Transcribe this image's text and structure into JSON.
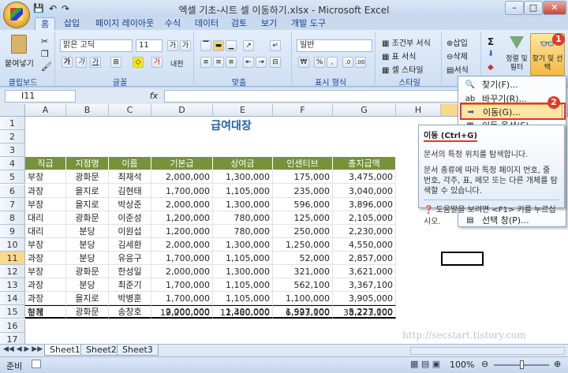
{
  "window": {
    "title": "엑셀 기초-시트 셀 이동하기.xlsx - Microsoft Excel",
    "min": "–",
    "max": "□",
    "close": "✕"
  },
  "qat": {
    "save": "💾",
    "undo": "↶",
    "redo": "↷"
  },
  "tabs": [
    "홈",
    "삽입",
    "페이지 레이아웃",
    "수식",
    "데이터",
    "검토",
    "보기",
    "개발 도구"
  ],
  "ribbon": {
    "clipboard": {
      "paste": "붙여넣기",
      "label": "클립보드"
    },
    "font": {
      "name": "맑은 고딕",
      "size": "11",
      "bold": "가",
      "italic": "가",
      "underline": "가",
      "grow": "가",
      "shrink": "가",
      "fontcolor": "가",
      "phonetic": "내천",
      "label": "글꼴"
    },
    "align": {
      "label": "맞춤"
    },
    "number": {
      "format": "일반",
      "percent": "%",
      "comma": ",",
      "currency": "₩",
      "label": "표시 형식"
    },
    "styles": {
      "cond": "조건부 서식",
      "table": "표 서식",
      "cell": "셀 스타일",
      "label": "스타일"
    },
    "cells": {
      "insert": "삽입",
      "delete": "삭제",
      "format": "서식"
    },
    "editing": {
      "sort": "정렬 및 필터",
      "find": "찾기 및 선택"
    }
  },
  "formula": {
    "namebox": "I11",
    "fx": "fx",
    "value": ""
  },
  "columns": [
    "A",
    "B",
    "C",
    "D",
    "E",
    "F",
    "G",
    "H",
    "I"
  ],
  "rows": [
    "1",
    "2",
    "3",
    "4",
    "5",
    "6",
    "7",
    "8",
    "9",
    "10",
    "11",
    "12",
    "13",
    "14",
    "15",
    "16",
    "17"
  ],
  "sheet": {
    "title": "급여대장",
    "headers": [
      "직급",
      "지점명",
      "이름",
      "기본급",
      "상여금",
      "인센티브",
      "총지급액"
    ],
    "data": [
      [
        "부장",
        "광화문",
        "최재석",
        "2,000,000",
        "1,300,000",
        "175,000",
        "3,475,000"
      ],
      [
        "과장",
        "을지로",
        "김현태",
        "1,700,000",
        "1,105,000",
        "235,000",
        "3,040,000"
      ],
      [
        "부장",
        "을지로",
        "박상준",
        "2,000,000",
        "1,300,000",
        "596,000",
        "3,896,000"
      ],
      [
        "대리",
        "광화문",
        "이준성",
        "1,200,000",
        "780,000",
        "125,000",
        "2,105,000"
      ],
      [
        "대리",
        "분당",
        "이원섭",
        "1,200,000",
        "780,000",
        "250,000",
        "2,230,000"
      ],
      [
        "부장",
        "분당",
        "김세환",
        "2,000,000",
        "1,300,000",
        "1,250,000",
        "4,550,000"
      ],
      [
        "과장",
        "분당",
        "유응구",
        "1,700,000",
        "1,105,000",
        "52,000",
        "2,857,000"
      ],
      [
        "부장",
        "광화문",
        "한성일",
        "2,000,000",
        "1,300,000",
        "321,000",
        "3,621,000"
      ],
      [
        "과장",
        "분당",
        "최준기",
        "1,700,000",
        "1,105,000",
        "562,100",
        "3,367,100"
      ],
      [
        "과장",
        "을지로",
        "박병훈",
        "1,700,000",
        "1,105,000",
        "1,100,000",
        "3,905,000"
      ],
      [
        "부장",
        "광화문",
        "송창호",
        "2,000,000",
        "1,300,000",
        "1,927,000",
        "5,227,000"
      ]
    ],
    "total": [
      "합계",
      "",
      "",
      "19,200,000",
      "12,480,000",
      "6,593,100",
      "38,273,100"
    ]
  },
  "menu": {
    "items": [
      "찾기(F)...",
      "바꾸기(R)...",
      "이동(G)...",
      "이동 옵션(S)...",
      "",
      "",
      "",
      "",
      "선택 창(P)..."
    ]
  },
  "tooltip": {
    "title": "이동 (Ctrl+G)",
    "line1": "문서의 특정 위치를 탐색합니다.",
    "line2": "문서 종류에 따라 특정 페이지 번호, 줄 번호, 각주, 표, 메모 또는 다른 개체를 탐색할 수 있습니다.",
    "help": "도움말을 보려면 <F1> 키를 누르십시오."
  },
  "badges": {
    "b1": "1",
    "b2": "2"
  },
  "sheettabs": [
    "Sheet1",
    "Sheet2",
    "Sheet3"
  ],
  "status": {
    "ready": "준비",
    "zoom": "100%"
  },
  "watermark": "http://secstart.tistory.com"
}
